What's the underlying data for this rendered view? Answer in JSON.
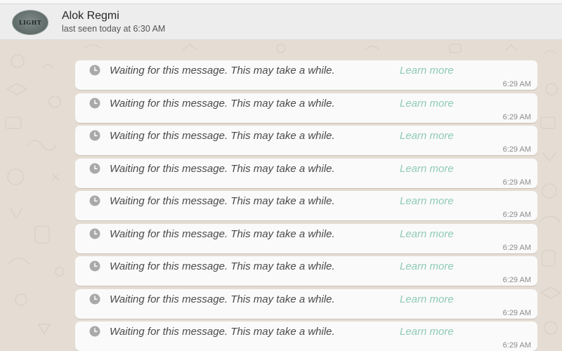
{
  "header": {
    "avatar_text": "LIGHT",
    "contact_name": "Alok Regmi",
    "last_seen": "last seen today at 6:30 AM"
  },
  "messages": [
    {
      "text": "Waiting for this message. This may take a while.",
      "link": "Learn more",
      "time": "6:29 AM",
      "icon": "clock-icon"
    },
    {
      "text": "Waiting for this message. This may take a while.",
      "link": "Learn more",
      "time": "6:29 AM",
      "icon": "clock-icon"
    },
    {
      "text": "Waiting for this message. This may take a while.",
      "link": "Learn more",
      "time": "6:29 AM",
      "icon": "clock-icon"
    },
    {
      "text": "Waiting for this message. This may take a while.",
      "link": "Learn more",
      "time": "6:29 AM",
      "icon": "clock-icon"
    },
    {
      "text": "Waiting for this message. This may take a while.",
      "link": "Learn more",
      "time": "6:29 AM",
      "icon": "clock-icon"
    },
    {
      "text": "Waiting for this message. This may take a while.",
      "link": "Learn more",
      "time": "6:29 AM",
      "icon": "clock-icon"
    },
    {
      "text": "Waiting for this message. This may take a while.",
      "link": "Learn more",
      "time": "6:29 AM",
      "icon": "clock-icon"
    },
    {
      "text": "Waiting for this message. This may take a while.",
      "link": "Learn more",
      "time": "6:29 AM",
      "icon": "clock-icon"
    },
    {
      "text": "Waiting for this message. This may take a while.",
      "link": "Learn more",
      "time": "6:29 AM",
      "icon": "clock-icon"
    }
  ],
  "colors": {
    "link": "#8fcbb4",
    "chat_background": "#e5ddd3",
    "bubble": "#fafafa"
  }
}
